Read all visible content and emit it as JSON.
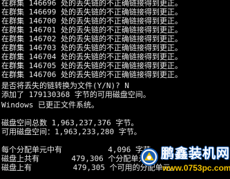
{
  "console": {
    "lost_chain_lines": [
      {
        "prefix": "在群集",
        "cluster": "146696",
        "suffix": "处的丢失链的不正确链接得到更正。"
      },
      {
        "prefix": "在群集",
        "cluster": "146699",
        "suffix": "处的丢失链的不正确链接得到更正。"
      },
      {
        "prefix": "在群集",
        "cluster": "146700",
        "suffix": "处的丢失链的不正确链接得到更正。"
      },
      {
        "prefix": "在群集",
        "cluster": "146701",
        "suffix": "处的丢失链的不正确链接得到更正。"
      },
      {
        "prefix": "在群集",
        "cluster": "146702",
        "suffix": "处的丢失链的不正确链接得到更正。"
      },
      {
        "prefix": "在群集",
        "cluster": "146703",
        "suffix": "处的丢失链的不正确链接得到更正。"
      },
      {
        "prefix": "在群集",
        "cluster": "146704",
        "suffix": "处的丢失链的不正确链接得到更正。"
      },
      {
        "prefix": "在群集",
        "cluster": "146705",
        "suffix": "处的丢失链的不正确链接得到更正。"
      },
      {
        "prefix": "在群集",
        "cluster": "146706",
        "suffix": "处的丢失链的不正确链接得到更正。"
      }
    ],
    "prompt": {
      "text": "是否将丢失的链转换为文件(Y/N)?",
      "answer": "N"
    },
    "added": {
      "prefix": "添加了",
      "bytes": "179130368",
      "suffix": "字节的可用磁盘空间。"
    },
    "fs_updated": {
      "prefix": "Windows",
      "suffix": "已更正文件系统。"
    },
    "total_space": {
      "label": "磁盘空间总数",
      "value": "1,963,237,376",
      "unit": "字节。"
    },
    "free_space": {
      "label": "可用磁盘空间：",
      "value": "1,963,233,280",
      "unit": "字节。"
    },
    "cluster_size": {
      "label": "每个分配单元中有",
      "value": "4,096",
      "unit": "字节。"
    },
    "total_units": {
      "label": "磁盘上共有",
      "value": "479,306",
      "unit": "个分配单元。"
    },
    "free_units": {
      "label": "磁盘上有",
      "value": "479,305",
      "unit": "个可用的分配单元。"
    },
    "text_color": "#e8e8e8",
    "background_color": "#000000"
  },
  "watermark": {
    "name": "鹏鑫装机网",
    "url": "www.0753pc.com",
    "name_color": "#ffffff",
    "url_color": "#f2c200"
  }
}
